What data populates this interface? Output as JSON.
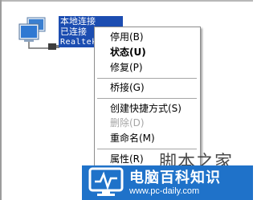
{
  "connection": {
    "name": "本地连接",
    "status": "已连接",
    "device": "Realtek",
    "icon": "network-connection-icon"
  },
  "context_menu": {
    "items": [
      {
        "label": "停用(B)",
        "bold": false,
        "disabled": false
      },
      {
        "label": "状态(U)",
        "bold": true,
        "disabled": false
      },
      {
        "label": "修复(P)",
        "bold": false,
        "disabled": false
      },
      {
        "label": "桥接(G)",
        "bold": false,
        "disabled": false
      },
      {
        "label": "创建快捷方式(S)",
        "bold": false,
        "disabled": false
      },
      {
        "label": "删除(D)",
        "bold": false,
        "disabled": true
      },
      {
        "label": "重命名(M)",
        "bold": false,
        "disabled": false
      },
      {
        "label": "属性(R)",
        "bold": false,
        "disabled": false
      }
    ]
  },
  "watermark": {
    "script_text": "脚本之家",
    "site_name": "电脑百科知识",
    "site_url": "www.pc-daily.com",
    "badge_color": "#1f72c9"
  }
}
